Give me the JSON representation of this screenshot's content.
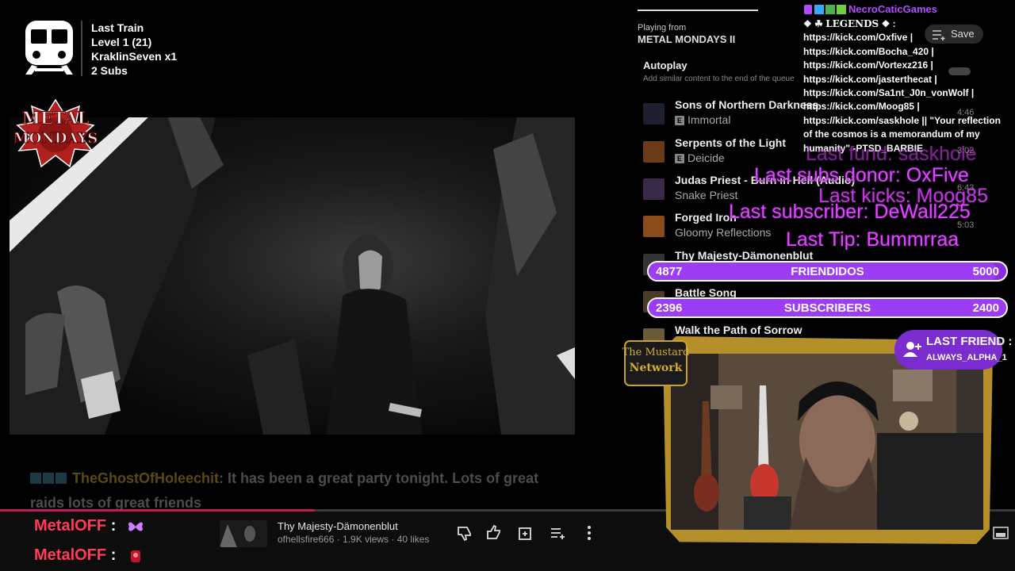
{
  "train": {
    "title": "Last Train",
    "level": "Level 1  (21)",
    "user": "KraklinSeven x1",
    "subs": "2 Subs"
  },
  "logo": {
    "line1": "METAL",
    "line2": "MONDAYS"
  },
  "chat_overlay": {
    "user": "TheGhostOfHoleechit",
    "message_line1": ": It has been a great party tonight. Lots of great",
    "message_line2": "raids lots of great friends"
  },
  "player": {
    "progress": 0.31,
    "viewers": [
      {
        "name": "MetalOFF",
        "sep": ":",
        "emote": "butterfly-emote"
      },
      {
        "name": "MetalOFF",
        "sep": ":",
        "emote": "red-emote"
      }
    ],
    "title": "Thy Majesty-Dämonenblut",
    "meta": "ofhellsfire666 · 1.9K views · 40 likes"
  },
  "playlist": {
    "playing_from": "Playing from",
    "name": "METAL MONDAYS II",
    "save": "Save",
    "autoplay": "Autoplay",
    "autoplay_desc": "Add similar content to the end of the queue",
    "items": [
      {
        "title": "Sons of Northern Darkness",
        "artist": "Immortal",
        "explicit": true,
        "duration": "4:46"
      },
      {
        "title": "Serpents of the Light",
        "artist": "Deicide",
        "explicit": true,
        "duration": "3:02"
      },
      {
        "title": "Judas Priest - Burn in Hell (Audio)",
        "artist": "Snake Priest",
        "explicit": false,
        "duration": "6:43"
      },
      {
        "title": "Forged Iron",
        "artist": "Gloomy Reflections",
        "explicit": false,
        "duration": "5:03"
      },
      {
        "title": "Thy Majesty-Dämonenblut",
        "artist": "",
        "explicit": false,
        "duration": ""
      },
      {
        "title": "Battle Song",
        "artist": "",
        "explicit": false,
        "duration": ""
      },
      {
        "title": "Walk the Path of Sorrow",
        "artist": "",
        "explicit": false,
        "duration": ""
      }
    ]
  },
  "stream_chat": {
    "user": "NecroCaticGames",
    "legend_text": "LEGENDS",
    "message": [
      "https://kick.com/Oxfive |",
      "https://kick.com/Bocha_420 |",
      "https://kick.com/Vortexz216 |",
      "https://kick.com/jasterthecat |",
      "https://kick.com/Sa1nt_J0n_vonWolf |",
      "https://kick.com/Moog85 |",
      "https://kick.com/saskhole || \"Your reflection",
      "of the cosmos is a memorandum of my",
      "humanity\" -PTSD_BARBIE"
    ]
  },
  "alerts": {
    "last_fund": "Last fund: saskhole",
    "last_subs_donor": "Last subs donor: OxFive",
    "last_kicks": "Last kicks: Moog85",
    "last_subscriber": "Last subscriber: DeWall225",
    "last_tip": "Last Tip: Bummrraa"
  },
  "goals": [
    {
      "current": 4877,
      "current_label": "4877",
      "label": "FRIENDIDOS",
      "target": 5000,
      "target_label": "5000"
    },
    {
      "current": 2396,
      "current_label": "2396",
      "label": "SUBSCRIBERS",
      "target": 2400,
      "target_label": "2400"
    }
  ],
  "last_friend": {
    "title": "LAST FRIEND :",
    "name": "ALWAYS_ALPHA_1"
  },
  "network_logo": {
    "line1": "The Mustard",
    "line2": "Network"
  },
  "colors": {
    "accent_pink": "#ff3b57",
    "purple": "#8a2be2",
    "alert": "#e045ff",
    "progress": "#c2185b"
  }
}
